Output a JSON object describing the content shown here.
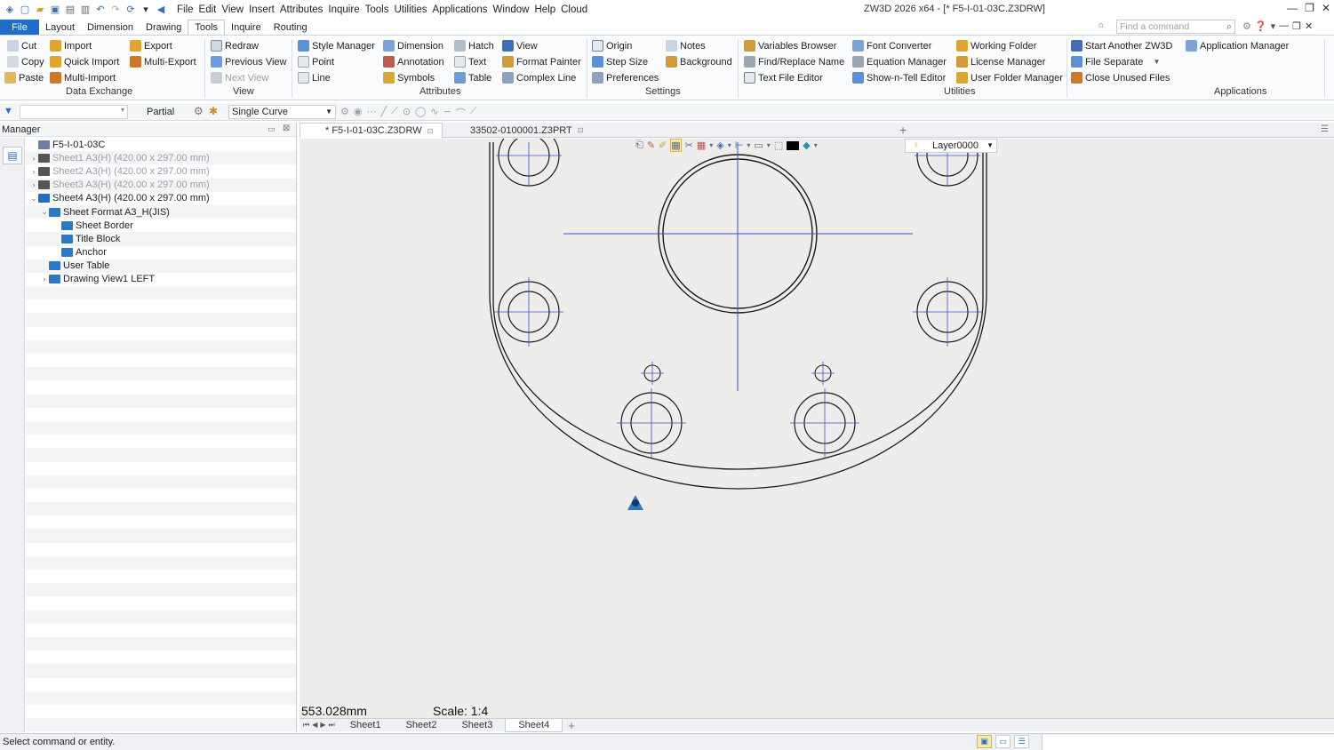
{
  "window": {
    "menu": [
      "File",
      "Edit",
      "View",
      "Insert",
      "Attributes",
      "Inquire",
      "Tools",
      "Utilities",
      "Applications",
      "Window",
      "Help",
      "Cloud"
    ],
    "title": "ZW3D 2026 x64  - [* F5-I-01-03C.Z3DRW]",
    "controls": [
      "—",
      "❐",
      "✕"
    ]
  },
  "ribbon_tabs": [
    "File",
    "Layout",
    "Dimension",
    "Drawing",
    "Tools",
    "Inquire",
    "Routing"
  ],
  "active_tab": "Tools",
  "command_search": {
    "placeholder": "Find a command"
  },
  "ribbon": {
    "data_exchange": {
      "title": "Data Exchange",
      "items": [
        "Cut",
        "Copy",
        "Paste",
        "Import",
        "Quick Import",
        "Multi-Import",
        "Export",
        "Multi-Export"
      ]
    },
    "view": {
      "title": "View",
      "items": [
        "Redraw",
        "Previous View",
        "Next View"
      ]
    },
    "attributes": {
      "title": "Attributes",
      "items": [
        "Style Manager",
        "Point",
        "Line",
        "Dimension",
        "Annotation",
        "Symbols",
        "Hatch",
        "Text",
        "Table",
        "View",
        "Format Painter",
        "Complex Line"
      ]
    },
    "settings": {
      "title": "Settings",
      "items": [
        "Origin",
        "Step Size",
        "Preferences",
        "Notes",
        "Background"
      ]
    },
    "utilities": {
      "title": "Utilities",
      "items": [
        "Variables Browser",
        "Find/Replace Name",
        "Text File Editor",
        "Font Converter",
        "Equation Manager",
        "Show-n-Tell Editor",
        "Working Folder",
        "License Manager",
        "User Folder Manager"
      ]
    },
    "applications": {
      "title": "Applications",
      "items": [
        "Start Another ZW3D",
        "File Separate",
        "Close Unused Files",
        "Application Manager"
      ]
    }
  },
  "filter_bar": {
    "filter_value": "",
    "partial_label": "Partial",
    "curve_mode": "Single Curve"
  },
  "manager": {
    "title": "Manager",
    "tree": [
      {
        "label": "F5-I-01-03C",
        "level": 0,
        "caret": "",
        "icon": "root-icon",
        "grey": false
      },
      {
        "label": "Sheet1 A3(H) (420.00 x 297.00 mm)",
        "level": 0,
        "caret": "›",
        "icon": "sheet-icon",
        "grey": true
      },
      {
        "label": "Sheet2 A3(H) (420.00 x 297.00 mm)",
        "level": 0,
        "caret": "›",
        "icon": "sheet-icon",
        "grey": true
      },
      {
        "label": "Sheet3 A3(H) (420.00 x 297.00 mm)",
        "level": 0,
        "caret": "›",
        "icon": "sheet-icon",
        "grey": true
      },
      {
        "label": "Sheet4 A3(H) (420.00 x 297.00 mm)",
        "level": 0,
        "caret": "⌄",
        "icon": "active-sheet-icon",
        "grey": false
      },
      {
        "label": "Sheet Format A3_H(JIS)",
        "level": 1,
        "caret": "⌄",
        "icon": "format-icon",
        "grey": false
      },
      {
        "label": "Sheet Border",
        "level": 2,
        "caret": "",
        "icon": "border-icon",
        "grey": false
      },
      {
        "label": "Title Block",
        "level": 2,
        "caret": "",
        "icon": "block-icon",
        "grey": false
      },
      {
        "label": "Anchor",
        "level": 2,
        "caret": "",
        "icon": "anchor-icon",
        "grey": false
      },
      {
        "label": "User Table",
        "level": 1,
        "caret": "",
        "icon": "table-icon",
        "grey": false
      },
      {
        "label": "Drawing View1 LEFT",
        "level": 1,
        "caret": "›",
        "icon": "view-icon",
        "grey": false
      }
    ]
  },
  "doc_tabs": [
    {
      "label": "* F5-I-01-03C.Z3DRW",
      "active": true
    },
    {
      "label": "33502-0100001.Z3PRT",
      "active": false
    }
  ],
  "canvas": {
    "layer": "Layer0000",
    "readout": "553.028mm",
    "scale": "Scale: 1:4"
  },
  "sheet_tabs": [
    "Sheet1",
    "Sheet2",
    "Sheet3",
    "Sheet4"
  ],
  "active_sheet": "Sheet4",
  "status": {
    "text": "Select command or entity."
  },
  "colors": {
    "accent": "#1e6ec8",
    "canvas": "#eeedec",
    "centerline": "#3f4fc7",
    "geometry": "#1a1a1a"
  }
}
